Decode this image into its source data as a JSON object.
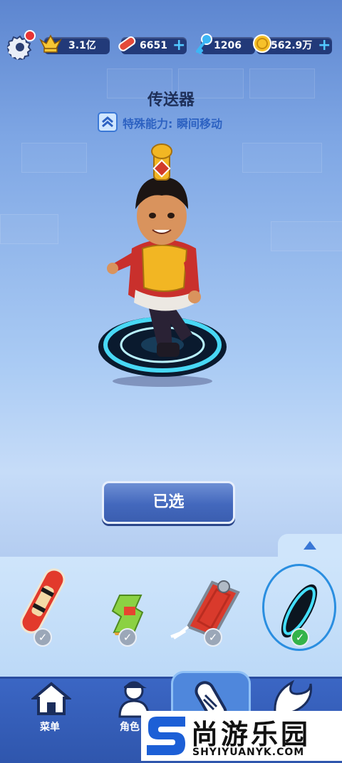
{
  "topbar": {
    "highscore": "3.1亿",
    "boards": "6651",
    "keys": "1206",
    "coins": "562.9万",
    "plus": "+"
  },
  "character": {
    "name": "传送器",
    "ability": "特殊能力: 瞬间移动"
  },
  "select_button": "已选",
  "boards": [
    {
      "id": "board-1",
      "owned": true,
      "selected": false
    },
    {
      "id": "board-2",
      "owned": true,
      "selected": false
    },
    {
      "id": "board-3",
      "owned": true,
      "selected": false
    },
    {
      "id": "board-4",
      "owned": true,
      "selected": true
    }
  ],
  "nav": {
    "items": [
      "菜单",
      "角色"
    ]
  },
  "watermark": {
    "cn": "尚游乐园",
    "en": "SHYIYUANYK.COM"
  },
  "colors": {
    "accent": "#3b66c4",
    "selected_check": "#34b34a",
    "unselected_check": "#9ba7b8"
  }
}
